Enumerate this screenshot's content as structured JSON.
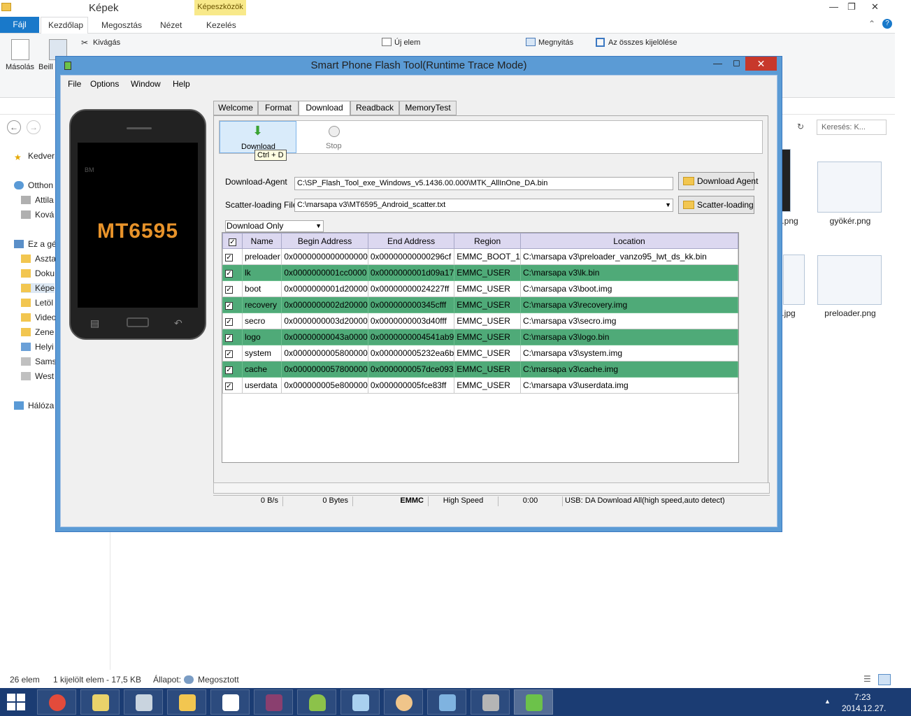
{
  "explorer": {
    "title": "Képek",
    "context_tab": "Képeszközök",
    "tabs": [
      "Fájl",
      "Kezdőlap",
      "Megosztás",
      "Nézet",
      "Kezelés"
    ],
    "ribbon": {
      "copy": "Másolás",
      "paste": "Beill",
      "cut": "Kivágás",
      "new_item": "Új elem",
      "open": "Megnyitás",
      "select_all": "Az összes kijelölése"
    },
    "search_placeholder": "Keresés: K...",
    "nav": [
      "Kedver",
      "Otthon",
      "Attila",
      "Ková",
      "Ez a gé",
      "Aszta",
      "Doku",
      "Képe",
      "Letöl",
      "Video",
      "Zene",
      "Helyi",
      "Sams",
      "West",
      "Hálóza"
    ],
    "thumbnails": [
      ".png",
      "gyökér.png",
      ".jpg",
      "preloader.png"
    ],
    "status": {
      "count": "26 elem",
      "selected": "1 kijelölt elem - 17,5 KB",
      "state_label": "Állapot:",
      "state_value": "Megosztott"
    }
  },
  "taskbar": {
    "time": "7:23",
    "date": "2014.12.27.",
    "buttons": [
      "start-button",
      "chrome",
      "explorer-notes",
      "calculator",
      "file-explorer",
      "apps",
      "winrar",
      "android",
      "notepad",
      "paint",
      "network",
      "remote",
      "flash-tool"
    ]
  },
  "flash_tool": {
    "title": "Smart Phone Flash Tool(Runtime Trace Mode)",
    "menu": [
      "File",
      "Options",
      "Window",
      "Help"
    ],
    "phone_model": "MT6595",
    "phone_brand": "BM",
    "tabs": [
      "Welcome",
      "Format",
      "Download",
      "Readback",
      "MemoryTest"
    ],
    "active_tab": "Download",
    "download_button": "Download",
    "tooltip": "Ctrl + D",
    "stop_button": "Stop",
    "download_agent_label": "Download-Agent",
    "download_agent_value": "C:\\SP_Flash_Tool_exe_Windows_v5.1436.00.000\\MTK_AllInOne_DA.bin",
    "download_agent_button": "Download Agent",
    "scatter_label": "Scatter-loading File",
    "scatter_value": "C:\\marsapa v3\\MT6595_Android_scatter.txt",
    "scatter_button": "Scatter-loading",
    "mode_select": "Download Only",
    "table": {
      "headers": [
        "Name",
        "Begin Address",
        "End Address",
        "Region",
        "Location"
      ],
      "rows": [
        {
          "name": "preloader",
          "begin": "0x0000000000000000",
          "end": "0x00000000000296cf",
          "region": "EMMC_BOOT_1",
          "location": "C:\\marsapa v3\\preloader_vanzo95_lwt_ds_kk.bin"
        },
        {
          "name": "lk",
          "begin": "0x0000000001cc0000",
          "end": "0x0000000001d09a17",
          "region": "EMMC_USER",
          "location": "C:\\marsapa v3\\lk.bin"
        },
        {
          "name": "boot",
          "begin": "0x0000000001d20000",
          "end": "0x00000000024227ff",
          "region": "EMMC_USER",
          "location": "C:\\marsapa v3\\boot.img"
        },
        {
          "name": "recovery",
          "begin": "0x0000000002d20000",
          "end": "0x000000000345cfff",
          "region": "EMMC_USER",
          "location": "C:\\marsapa v3\\recovery.img"
        },
        {
          "name": "secro",
          "begin": "0x0000000003d20000",
          "end": "0x0000000003d40fff",
          "region": "EMMC_USER",
          "location": "C:\\marsapa v3\\secro.img"
        },
        {
          "name": "logo",
          "begin": "0x00000000043a0000",
          "end": "0x0000000004541ab9",
          "region": "EMMC_USER",
          "location": "C:\\marsapa v3\\logo.bin"
        },
        {
          "name": "system",
          "begin": "0x0000000005800000",
          "end": "0x000000005232ea6b",
          "region": "EMMC_USER",
          "location": "C:\\marsapa v3\\system.img"
        },
        {
          "name": "cache",
          "begin": "0x0000000057800000",
          "end": "0x0000000057dce093",
          "region": "EMMC_USER",
          "location": "C:\\marsapa v3\\cache.img"
        },
        {
          "name": "userdata",
          "begin": "0x000000005e800000",
          "end": "0x000000005fce83ff",
          "region": "EMMC_USER",
          "location": "C:\\marsapa v3\\userdata.img"
        }
      ]
    },
    "status": {
      "speed": "0 B/s",
      "bytes": "0 Bytes",
      "storage": "EMMC",
      "mode": "High Speed",
      "time": "0:00",
      "usb": "USB: DA Download All(high speed,auto detect)"
    }
  },
  "colors": {
    "highlight_row": "#4faa78",
    "window_frame": "#5b9bd5",
    "taskbar": "#1b3c73",
    "close_button": "#c7382b"
  }
}
